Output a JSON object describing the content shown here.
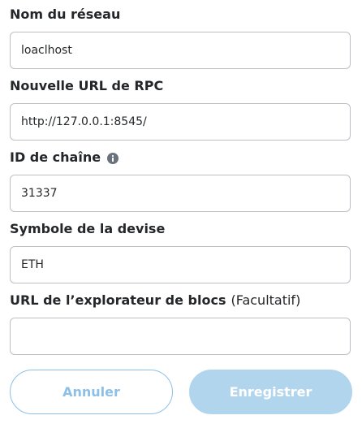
{
  "form": {
    "network_name": {
      "label": "Nom du réseau",
      "value": "loaclhost"
    },
    "rpc_url": {
      "label": "Nouvelle URL de RPC",
      "value": "http://127.0.0.1:8545/"
    },
    "chain_id": {
      "label": "ID de chaîne",
      "info_icon": "info-icon",
      "value": "31337"
    },
    "currency_symbol": {
      "label": "Symbole de la devise",
      "value": "ETH"
    },
    "block_explorer": {
      "label": "URL de l’explorateur de blocs",
      "optional_label": "(Facultatif)",
      "value": ""
    }
  },
  "actions": {
    "cancel_label": "Annuler",
    "save_label": "Enregistrer"
  },
  "colors": {
    "primary": "#0376c9",
    "text": "#24272a",
    "border": "#bbc0c5"
  }
}
